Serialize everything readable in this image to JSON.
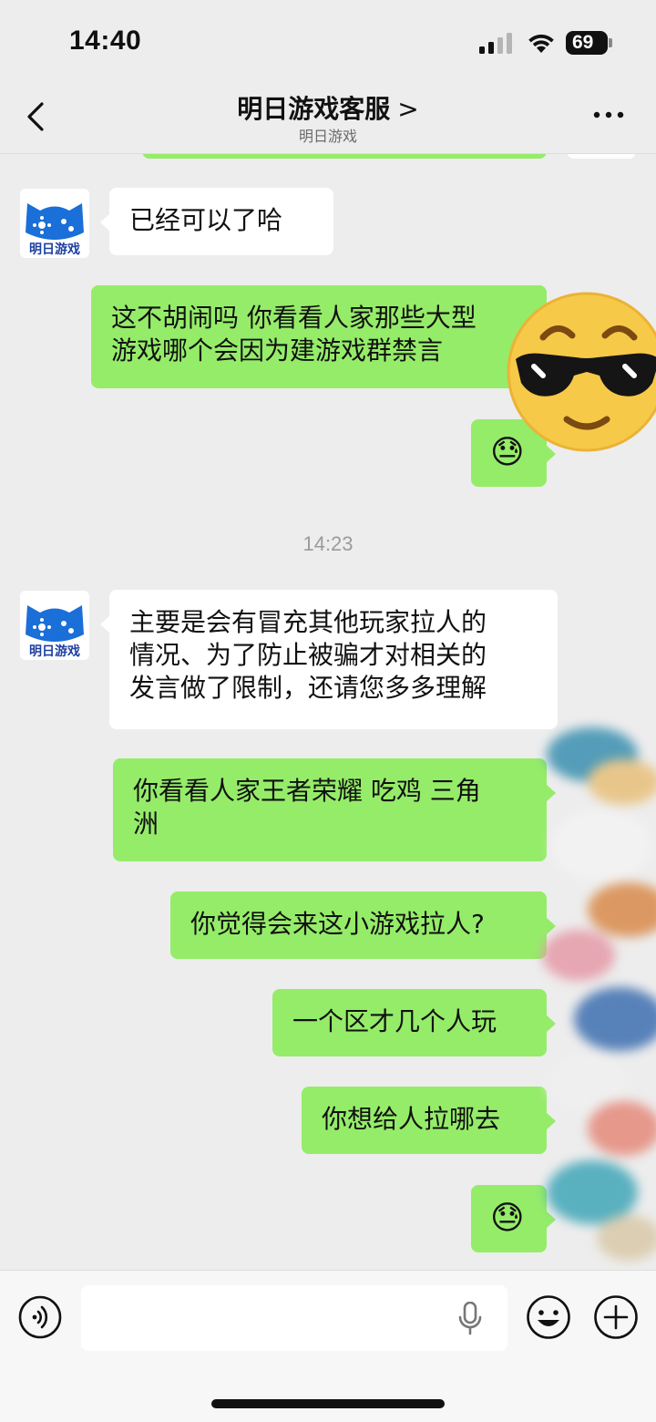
{
  "status_bar": {
    "time": "14:40",
    "battery": "69"
  },
  "header": {
    "title": "明日游戏客服",
    "chevron": ">",
    "subtitle": "明日游戏"
  },
  "avatar": {
    "brand": "明日游戏"
  },
  "colors": {
    "background": "#ededed",
    "outgoing_bubble": "#95ec69",
    "incoming_bubble": "#ffffff",
    "brand_blue": "#1a6fd8"
  },
  "messages": [
    {
      "side": "left",
      "text": "已经可以了哈"
    },
    {
      "side": "right",
      "text": "这不胡闹吗 你看看人家那些大型\n游戏哪个会因为建游戏群禁言"
    },
    {
      "side": "right",
      "emoji": "😓"
    },
    {
      "side": "left",
      "text": "主要是会有冒充其他玩家拉人的\n情况、为了防止被骗才对相关的\n发言做了限制，还请您多多理解"
    },
    {
      "side": "right",
      "text": "你看看人家王者荣耀 吃鸡 三角\n洲"
    },
    {
      "side": "right",
      "text": "你觉得会来这小游戏拉人?"
    },
    {
      "side": "right",
      "text": "一个区才几个人玩"
    },
    {
      "side": "right",
      "text": "你想给人拉哪去"
    },
    {
      "side": "right",
      "emoji": "😓"
    }
  ],
  "timestamp": "14:23",
  "input": {
    "value": "",
    "placeholder": ""
  },
  "icons": [
    "back-arrow-icon",
    "more-icon",
    "voice-icon",
    "microphone-icon",
    "emoji-icon",
    "plus-icon"
  ]
}
